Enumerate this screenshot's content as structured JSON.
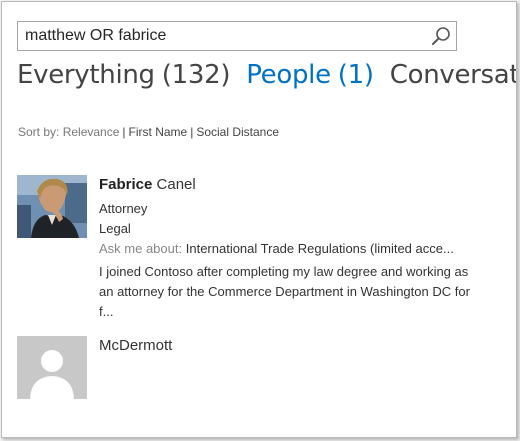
{
  "search": {
    "query": "matthew OR fabrice",
    "icon": "search-icon"
  },
  "tabs": [
    {
      "label": "Everything",
      "count": "(132)",
      "active": false
    },
    {
      "label": "People",
      "count": "(1)",
      "active": true
    },
    {
      "label": "Conversations",
      "count": "",
      "active": false
    }
  ],
  "colors": {
    "accent": "#0072c6",
    "tab_inactive": "#444444"
  },
  "sort": {
    "label": "Sort by:",
    "options": [
      "Relevance",
      "First Name",
      "Social Distance"
    ]
  },
  "results": [
    {
      "first_name": "Fabrice",
      "last_name": "Canel",
      "title": "Attorney",
      "department": "Legal",
      "ask_label": "Ask me about:",
      "ask_topic": "International Trade Regulations (limited acce...",
      "bio": "I joined Contoso after completing my law degree and working as an attorney for the Commerce Department in Washington DC for f...",
      "avatar": "photo"
    },
    {
      "first_name": "",
      "last_name": "McDermott",
      "avatar": "placeholder-person-icon"
    }
  ]
}
